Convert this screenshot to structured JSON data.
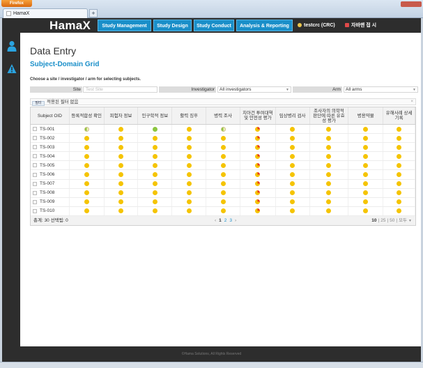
{
  "browser": {
    "app_button": "Firefox",
    "tab_title": "HamaX",
    "new_tab": "+"
  },
  "header": {
    "logo": "HamaX",
    "nav": [
      "Study Management",
      "Study Design",
      "Study Conduct",
      "Analysis & Reporting"
    ],
    "user": "testcrc (CRC)",
    "language": "자바맨 접 시"
  },
  "page": {
    "title": "Data Entry",
    "subtitle": "Subject-Domain Grid",
    "instruction": "Choose a site / investigator / arm for selecting subjects."
  },
  "filters": {
    "site_label": "Site",
    "site_placeholder": "Test Site",
    "investigator_label": "Investigator",
    "investigator_value": "All investigators",
    "arm_label": "Arm",
    "arm_value": "All arms"
  },
  "applied_filter": {
    "icon_text": "필터",
    "text": "적용된 필터 없음",
    "close": "×"
  },
  "grid": {
    "columns": [
      "Subject OID",
      "등록적합성 확인",
      "피험자 정보",
      "인구학적 정보",
      "활력 징후",
      "병력 조사",
      "치아건 투여대역 및 안전성 평가",
      "임상병리 검사",
      "조사자의 의학적 판단에 따른 유효성 평가",
      "병용약물",
      "유해사례 상세 기록"
    ],
    "rows": [
      {
        "id": "TS-001",
        "status": [
          "half",
          "yellow",
          "green",
          "yellow",
          "half",
          "red",
          "yellow",
          "yellow",
          "yellow",
          "yellow"
        ]
      },
      {
        "id": "TS-002",
        "status": [
          "yellow",
          "yellow",
          "yellow",
          "yellow",
          "yellow",
          "red",
          "yellow",
          "yellow",
          "yellow",
          "yellow"
        ]
      },
      {
        "id": "TS-003",
        "status": [
          "yellow",
          "yellow",
          "yellow",
          "yellow",
          "yellow",
          "red",
          "yellow",
          "yellow",
          "yellow",
          "yellow"
        ]
      },
      {
        "id": "TS-004",
        "status": [
          "yellow",
          "yellow",
          "yellow",
          "yellow",
          "yellow",
          "red",
          "yellow",
          "yellow",
          "yellow",
          "yellow"
        ]
      },
      {
        "id": "TS-005",
        "status": [
          "yellow",
          "yellow",
          "yellow",
          "yellow",
          "yellow",
          "red",
          "yellow",
          "yellow",
          "yellow",
          "yellow"
        ]
      },
      {
        "id": "TS-006",
        "status": [
          "yellow",
          "yellow",
          "yellow",
          "yellow",
          "yellow",
          "red",
          "yellow",
          "yellow",
          "yellow",
          "yellow"
        ]
      },
      {
        "id": "TS-007",
        "status": [
          "yellow",
          "yellow",
          "yellow",
          "yellow",
          "yellow",
          "red",
          "yellow",
          "yellow",
          "yellow",
          "yellow"
        ]
      },
      {
        "id": "TS-008",
        "status": [
          "yellow",
          "yellow",
          "yellow",
          "yellow",
          "yellow",
          "red",
          "yellow",
          "yellow",
          "yellow",
          "yellow"
        ]
      },
      {
        "id": "TS-009",
        "status": [
          "yellow",
          "yellow",
          "yellow",
          "yellow",
          "yellow",
          "red",
          "yellow",
          "yellow",
          "yellow",
          "yellow"
        ]
      },
      {
        "id": "TS-010",
        "status": [
          "yellow",
          "yellow",
          "yellow",
          "yellow",
          "yellow",
          "red",
          "yellow",
          "yellow",
          "yellow",
          "yellow"
        ]
      }
    ],
    "footer": {
      "summary": "총계: 30 선택됨: 0",
      "pages": [
        "1",
        "2",
        "3"
      ],
      "current_page": "1",
      "page_sizes": [
        "10",
        "25",
        "50",
        "모두"
      ],
      "current_size": "10"
    }
  },
  "footer_text": "©Hama Solutions, All Rights Reserved",
  "colors": {
    "accent": "#1a8fc9",
    "dark": "#2d2d2d",
    "status_yellow": "#f5c400",
    "status_green": "#8cc63f",
    "status_red": "#e8391f"
  }
}
